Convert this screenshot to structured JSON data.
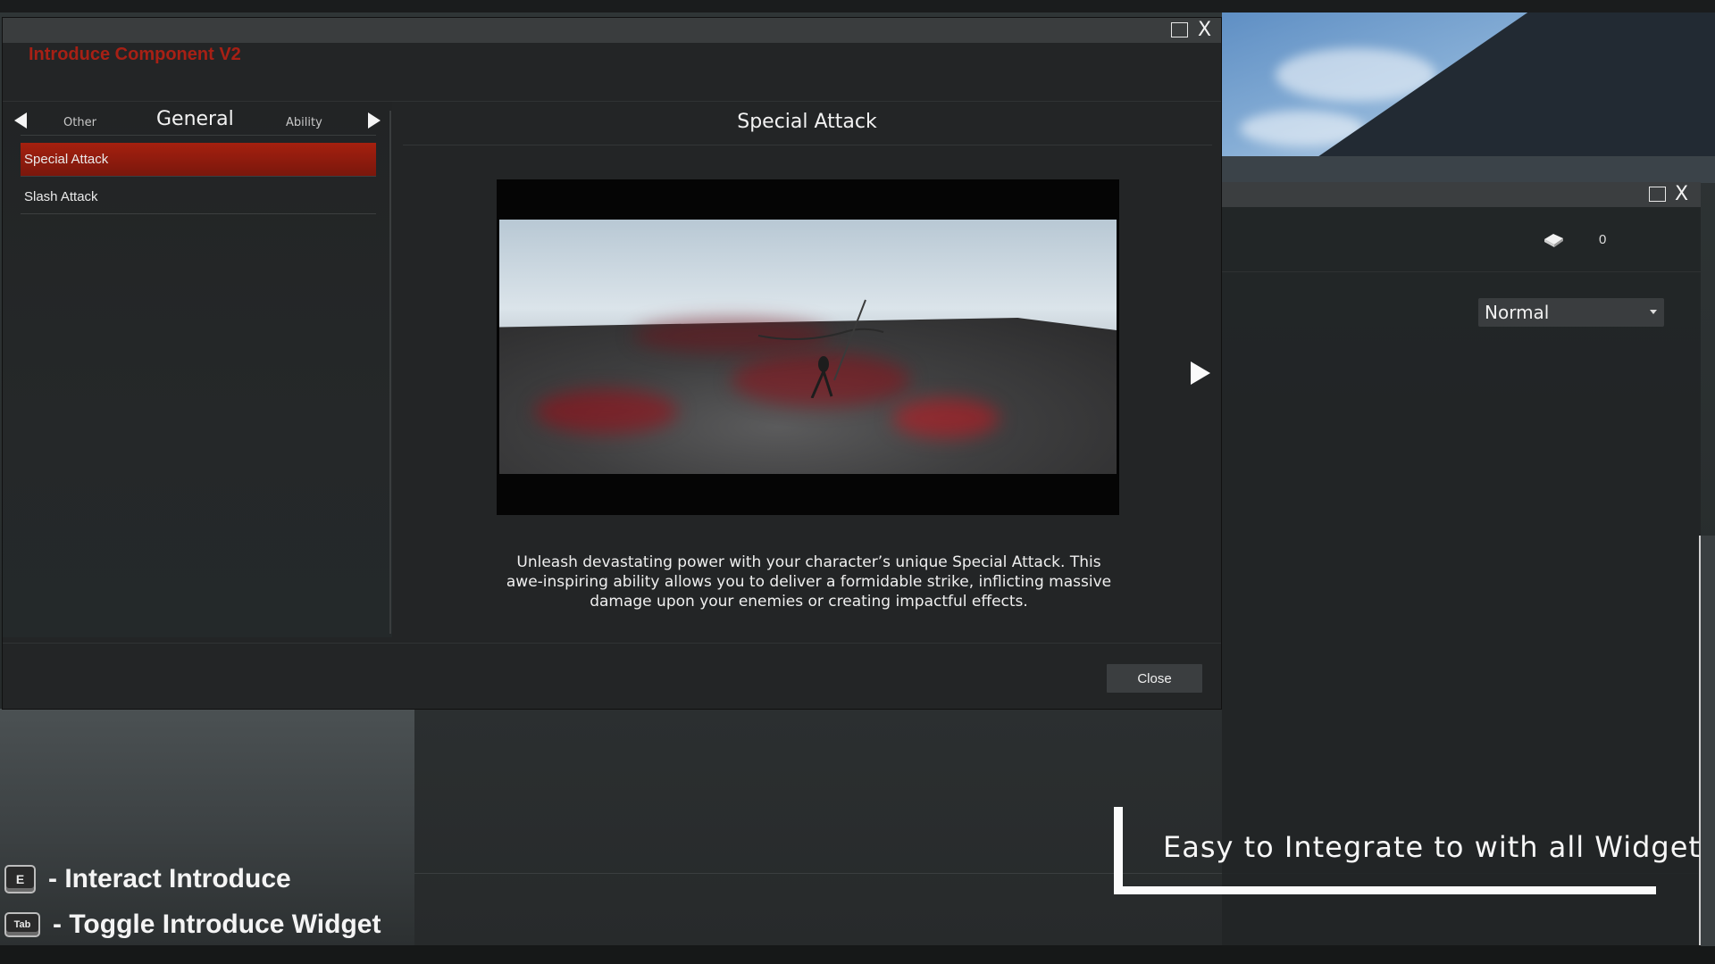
{
  "main_window": {
    "title": "Introduce Component V2",
    "controls": {
      "maximize_icon": "maximize-icon",
      "close_label": "X"
    },
    "tabs": {
      "prev": "Other",
      "current": "General",
      "next": "Ability"
    },
    "list": [
      {
        "label": "Special Attack",
        "selected": true
      },
      {
        "label": "Slash Attack",
        "selected": false
      }
    ],
    "content": {
      "title": "Special Attack",
      "description": "Unleash devastating power with your character’s unique Special Attack. This awe-inspiring ability allows you to deliver a formidable strike, inflicting massive damage upon your enemies or creating impactful effects."
    },
    "close_button": "Close"
  },
  "second_window": {
    "controls": {
      "close_label": "X"
    },
    "resource_icon": "eraser-icon",
    "resource_count": "0",
    "dropdown_selected": "Normal"
  },
  "hints": [
    {
      "key": "E",
      "text": "- Interact Introduce"
    },
    {
      "key": "Tab",
      "text": "- Toggle Introduce Widget"
    }
  ],
  "banner": {
    "text": "Easy to Integrate to with all Widget"
  },
  "colors": {
    "accent_red": "#a72015",
    "selected_row": "#8f1c0e",
    "panel_bg": "#232526"
  }
}
